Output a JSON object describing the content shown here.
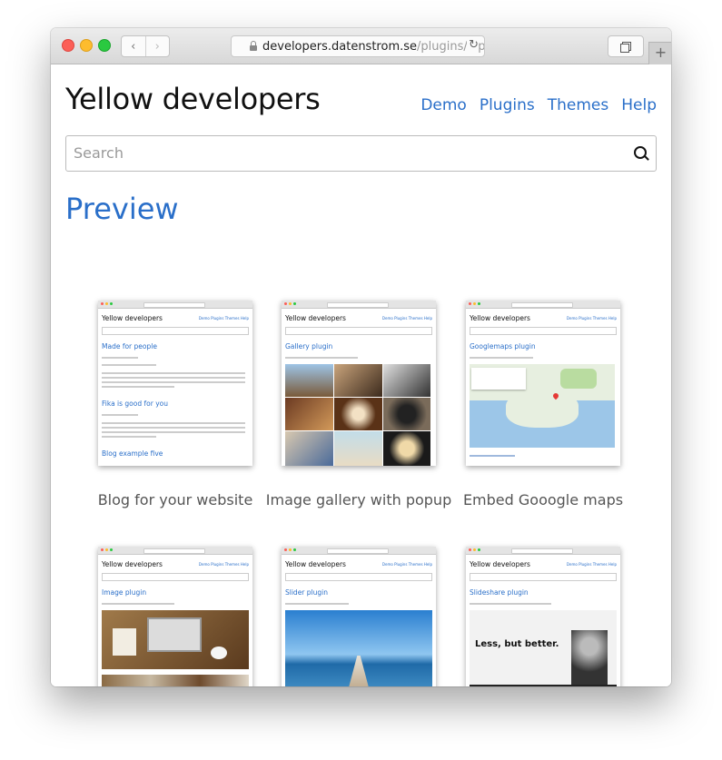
{
  "browser": {
    "url_host": "developers.datenstrom.se",
    "url_path": "/plugins/z-p",
    "back": "‹",
    "forward": "›",
    "reload": "↻",
    "new_tab": "+"
  },
  "site": {
    "name": "Yellow developers",
    "nav": [
      "Demo",
      "Plugins",
      "Themes",
      "Help"
    ],
    "search_placeholder": "Search"
  },
  "heading": "Preview",
  "cards": [
    {
      "title": "Made for people",
      "caption": "Blog for your website",
      "secondary": "Fika is good for you",
      "tertiary": "Blog example five"
    },
    {
      "title": "Gallery plugin",
      "caption": "Image gallery with popup"
    },
    {
      "title": "Googlemaps plugin",
      "caption": "Embed Gooogle maps"
    },
    {
      "title": "Image plugin",
      "caption": ""
    },
    {
      "title": "Slider plugin",
      "caption": ""
    },
    {
      "title": "Slideshare plugin",
      "caption": "",
      "slide_text": "Less, but better."
    }
  ],
  "colors": {
    "link": "#2a6fc9",
    "text": "#111111",
    "caption": "#555555"
  }
}
